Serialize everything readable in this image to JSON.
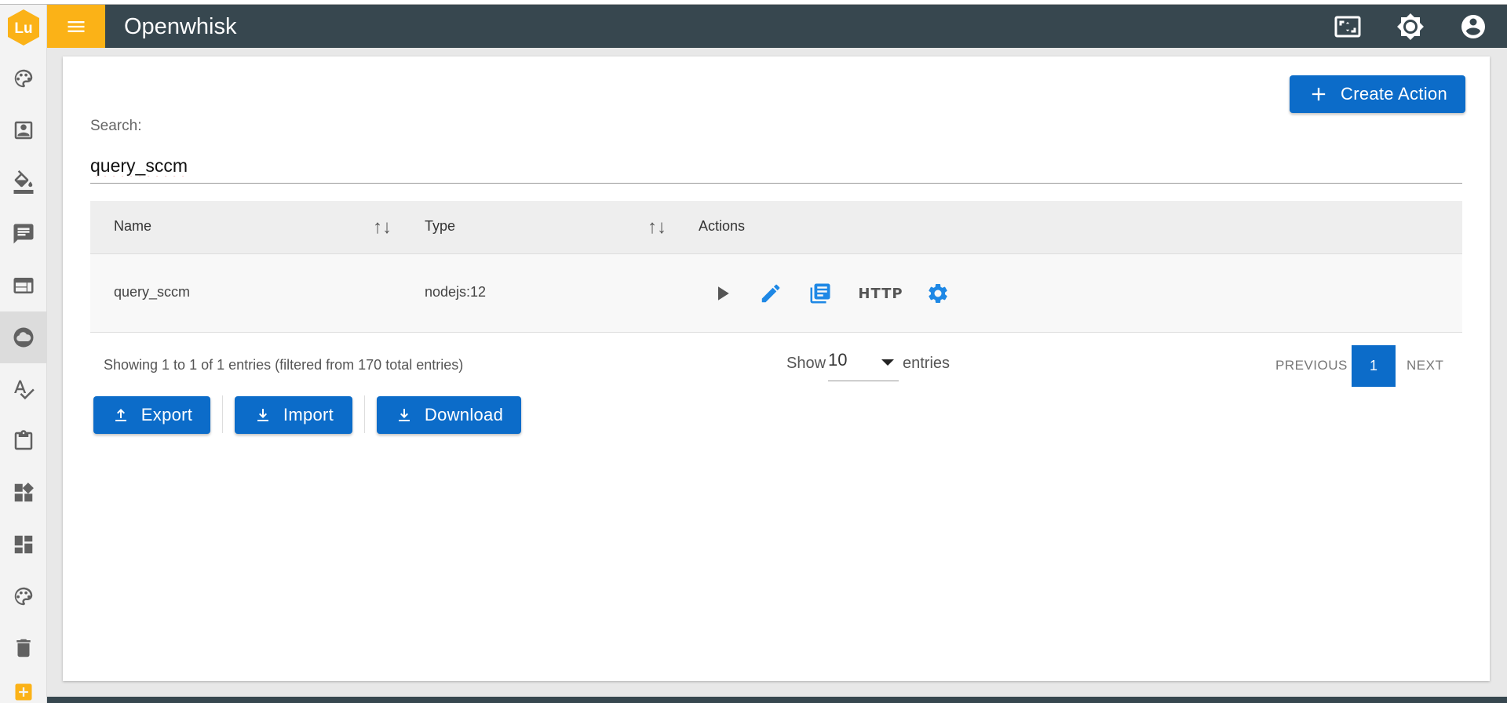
{
  "app": {
    "title": "Openwhisk",
    "logo_text": "Lu",
    "brand_color": "#fbb217",
    "header_color": "#37474f",
    "accent_color": "#0c6cc9"
  },
  "header_icons": [
    "fullscreen-icon",
    "brightness-icon",
    "account-circle-icon"
  ],
  "sidebar": {
    "items": [
      {
        "icon": "palette-icon"
      },
      {
        "icon": "contact-card-icon"
      },
      {
        "icon": "paint-bucket-icon"
      },
      {
        "icon": "chat-icon"
      },
      {
        "icon": "web-layout-icon"
      },
      {
        "icon": "cloud-icon",
        "active": true
      },
      {
        "icon": "spellcheck-icon"
      },
      {
        "icon": "clipboard-icon"
      },
      {
        "icon": "widgets-icon"
      },
      {
        "icon": "dashboard-icon"
      },
      {
        "icon": "palette-icon"
      },
      {
        "icon": "trash-icon"
      },
      {
        "icon": "add-box-icon"
      }
    ]
  },
  "toolbar": {
    "create_label": "Create Action"
  },
  "search": {
    "label": "Search:",
    "value": "query_sccm"
  },
  "table": {
    "columns": [
      "Name",
      "Type",
      "Actions"
    ],
    "rows": [
      {
        "name": "query_sccm",
        "type": "nodejs:12",
        "actions": [
          "play-icon",
          "edit-icon",
          "library-books-icon",
          "HTTP",
          "settings-icon"
        ]
      }
    ]
  },
  "footer": {
    "info": "Showing 1 to 1 of 1 entries (filtered from 170 total entries)",
    "show_label": "Show",
    "page_size": "10",
    "entries_label": "entries",
    "prev_label": "PREVIOUS",
    "current_page": "1",
    "next_label": "NEXT"
  },
  "buttons": {
    "export": "Export",
    "import": "Import",
    "download": "Download"
  }
}
